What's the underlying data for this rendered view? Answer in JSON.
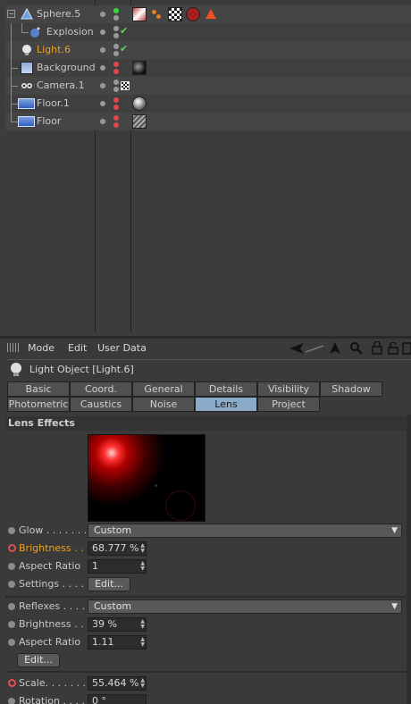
{
  "objects": [
    {
      "name": "Sphere.5",
      "selected": false
    },
    {
      "name": "Explosion",
      "selected": false
    },
    {
      "name": "Light.6",
      "selected": true
    },
    {
      "name": "Background",
      "selected": false
    },
    {
      "name": "Camera.1",
      "selected": false
    },
    {
      "name": "Floor.1",
      "selected": false
    },
    {
      "name": "Floor",
      "selected": false
    }
  ],
  "menu": {
    "mode": "Mode",
    "edit": "Edit",
    "user_data": "User Data"
  },
  "object_title": "Light Object [Light.6]",
  "tabs_row1": [
    "Basic",
    "Coord.",
    "General",
    "Details",
    "Visibility",
    "Shadow"
  ],
  "tabs_row2": [
    "Photometric",
    "Caustics",
    "Noise",
    "Lens",
    "Project"
  ],
  "active_tab": "Lens",
  "section_title": "Lens Effects",
  "glow": {
    "label": "Glow . . . . . . . .",
    "value": "Custom",
    "brightness_label": "Brightness . . .",
    "brightness": "68.777 %",
    "aspect_label": "Aspect Ratio",
    "aspect": "1",
    "settings_label": "Settings . . . .",
    "edit_label": "Edit..."
  },
  "reflexes": {
    "label": "Reflexes . . . . .",
    "value": "Custom",
    "brightness_label": "Brightness . . .",
    "brightness": "39 %",
    "aspect_label": "Aspect Ratio",
    "aspect": "1.11",
    "edit_label": "Edit..."
  },
  "scale": {
    "label": "Scale. . . . . . . .",
    "value": "55.464 %"
  },
  "rotation": {
    "label": "Rotation . . . . .",
    "value": "0 °"
  },
  "colors": {
    "accent": "#f0a020",
    "active_tab": "#8ba9c8",
    "anim_key": "#e05050"
  }
}
